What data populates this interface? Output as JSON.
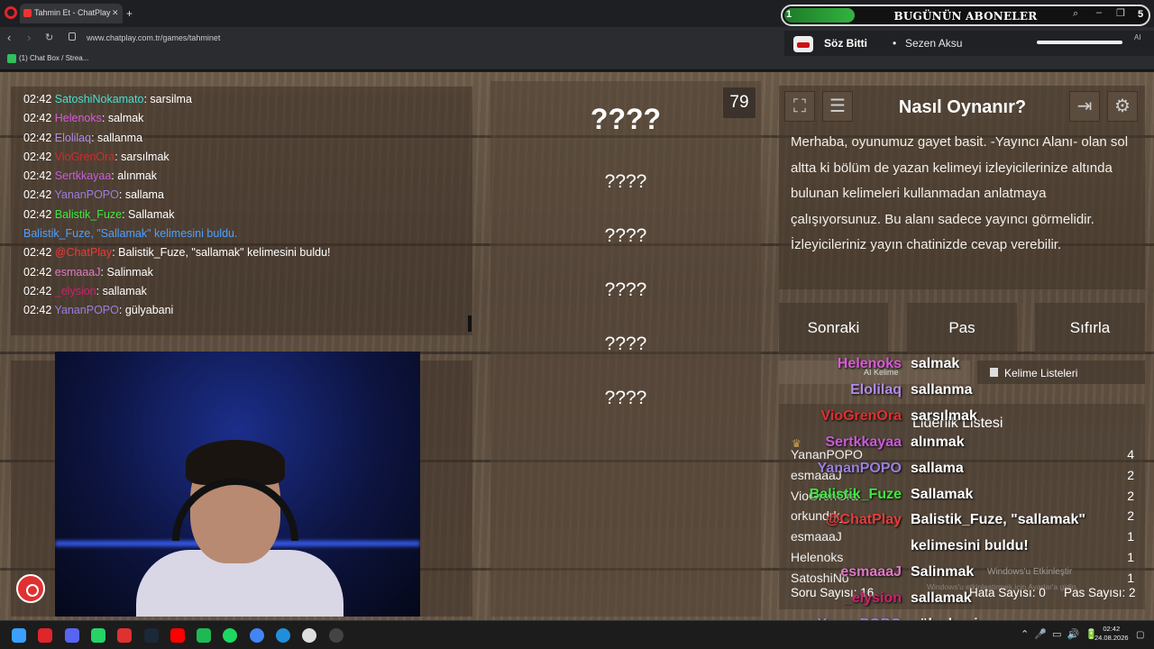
{
  "browser": {
    "tab_title": "Tahmin Et - ChatPlay",
    "url": "www.chatplay.com.tr/games/tahminet",
    "bookmark": "(1) Chat Box / Strea..."
  },
  "subs_overlay": {
    "count": "1",
    "title": "BUGÜNÜN ABONELER",
    "goal": "5"
  },
  "music": {
    "song": "Söz Bitti",
    "sep": "•",
    "artist": "Sezen Aksu",
    "side": "AI"
  },
  "chat": [
    {
      "time": "02:42",
      "user": "SatoshiNokamato",
      "color": "#40e0d0",
      "msg": ": sarsilma"
    },
    {
      "time": "02:42",
      "user": "Helenoks",
      "color": "#d95ad9",
      "msg": ": salmak"
    },
    {
      "time": "02:42",
      "user": "Elolilaq",
      "color": "#b38bea",
      "msg": ": sallanma"
    },
    {
      "time": "02:42",
      "user": "VioGrenOra",
      "color": "#d22c2c",
      "msg": ": sarsılmak"
    },
    {
      "time": "02:42",
      "user": "Sertkkayaa",
      "color": "#c65dd6",
      "msg": ": alınmak"
    },
    {
      "time": "02:42",
      "user": "YananPOPO",
      "color": "#9a7fe0",
      "msg": ": sallama"
    },
    {
      "time": "02:42",
      "user": "Balistik_Fuze",
      "color": "#3ee83e",
      "msg": ": Sallamak"
    },
    {
      "time": "",
      "user": "Balistik_Fuze, \"Sallamak\" kelimesini buldu.",
      "color": "#4da0ff",
      "msg": ""
    },
    {
      "time": "02:42",
      "user": "@ChatPlay",
      "color": "#e63c3c",
      "msg": ": Balistik_Fuze, \"sallamak\" kelimesini buldu!"
    },
    {
      "time": "02:42",
      "user": "esmaaaJ",
      "color": "#e079c5",
      "msg": ": Salinmak"
    },
    {
      "time": "02:42",
      "user": "_elysion",
      "color": "#d0206e",
      "msg": ": sallamak"
    },
    {
      "time": "02:42",
      "user": "YananPOPO",
      "color": "#9a7fe0",
      "msg": ": gülyabani"
    }
  ],
  "game": {
    "counter": "79",
    "main_word": "????",
    "hidden_words": [
      "????",
      "????",
      "????",
      "????",
      "????"
    ]
  },
  "info": {
    "title": "Nasıl Oynanır?",
    "text": "Merhaba, oyunumuz gayet basit. -Yayıncı Alanı- olan sol altta ki bölüm de yazan kelimeyi izleyicilerinize altında bulunan kelimeleri kullanmadan anlatmaya çalışıyorsunuz. Bu alanı sadece yayıncı görmelidir. İzleyicileriniz yayın chatinizde cevap verebilir."
  },
  "buttons": {
    "next": "Sonraki",
    "pass": "Pas",
    "reset": "Sıfırla"
  },
  "word_lists": {
    "ai_label": "AI Kelime",
    "lists_label": "Kelime Listeleri"
  },
  "leaderboard": {
    "title": "Liderlik Listesi",
    "names": [
      "YananPOPO",
      "esmaaaJ",
      "VioGrenOra",
      "orkundrk_",
      "esmaaaJ",
      "Helenoks",
      "SatoshiNo"
    ],
    "scores": [
      "4",
      "2",
      "2",
      "2",
      "1",
      "1",
      "1"
    ]
  },
  "stats": {
    "questions": "Soru Sayısı: 16",
    "errors": "Hata Sayısı: 0",
    "passes": "Pas Sayısı: 2"
  },
  "windows_activate": "Windows'u Etkinleştir",
  "windows_activate_sub": "Windows'u etkinleştirmek için Ayarlar'a gidin.",
  "overlay_chat": [
    {
      "user": "Helenoks",
      "color": "#d95ad9",
      "msg": "salmak"
    },
    {
      "user": "Elolilaq",
      "color": "#b38bea",
      "msg": "sallanma"
    },
    {
      "user": "VioGrenOra",
      "color": "#e03030",
      "msg": "sarsılmak"
    },
    {
      "user": "Sertkkayaa",
      "color": "#c65dd6",
      "msg": "alınmak"
    },
    {
      "user": "YananPOPO",
      "color": "#9a7fe0",
      "msg": "sallama"
    },
    {
      "user": "Balistik_Fuze",
      "color": "#3ee83e",
      "msg": "Sallamak"
    },
    {
      "user": "@ChatPlay",
      "color": "#e63c3c",
      "msg": "Balistik_Fuze, \"sallamak\""
    },
    {
      "user": "",
      "color": "#ffffff",
      "msg": "kelimesini buldu!"
    },
    {
      "user": "esmaaaJ",
      "color": "#e079c5",
      "msg": "Salinmak"
    },
    {
      "user": "_elysion",
      "color": "#d0206e",
      "msg": "sallamak"
    },
    {
      "user": "YananPOPO",
      "color": "#9a7fe0",
      "msg": "gülyabani"
    }
  ],
  "taskbar": {
    "time": "02:42",
    "date": "24.08.2026",
    "apps": [
      "windows-start",
      "opera",
      "discord",
      "whatsapp",
      "app-red",
      "steam",
      "youtube",
      "app-green",
      "spotify",
      "chrome",
      "edge",
      "yandex",
      "obs"
    ]
  }
}
